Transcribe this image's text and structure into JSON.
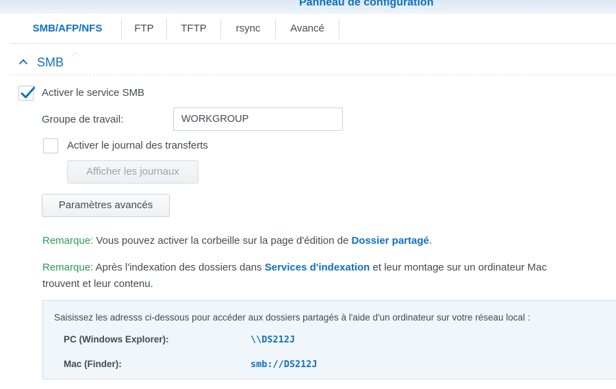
{
  "window": {
    "title": "Panneau de configuration"
  },
  "tabs": [
    {
      "label": "SMB/AFP/NFS",
      "active": true
    },
    {
      "label": "FTP"
    },
    {
      "label": "TFTP"
    },
    {
      "label": "rsync"
    },
    {
      "label": "Avancé"
    }
  ],
  "smb": {
    "section_title": "SMB",
    "enable_label": "Activer le service SMB",
    "enable_checked": true,
    "workgroup_label": "Groupe de travail:",
    "workgroup_value": "WORKGROUP",
    "transfer_log_label": "Activer le journal des transferts",
    "transfer_log_checked": false,
    "show_logs_button": "Afficher les journaux",
    "advanced_button": "Paramètres avancés"
  },
  "notes": [
    {
      "prefix": "Remarque:",
      "before": " Vous pouvez activer la corbeille sur la page d'édition de ",
      "link": "Dossier partagé",
      "after": "."
    },
    {
      "prefix": "Remarque:",
      "before": " Après l'indexation des dossiers dans ",
      "link": "Services d'indexation",
      "after": " et leur montage sur un ordinateur Mac",
      "line2": "trouvent et leur contenu."
    }
  ],
  "info": {
    "intro": "Saisissez les adresss ci-dessous pour accéder aux dossiers partagés à l'aide d'un ordinateur sur votre réseau local :",
    "rows": [
      {
        "key": "PC (Windows Explorer):",
        "value": "\\\\DS212J"
      },
      {
        "key": "Mac (Finder):",
        "value": "smb://DS212J"
      }
    ]
  },
  "colors": {
    "accent": "#0f70c2",
    "note_prefix": "#2a9a55",
    "text": "#414b55",
    "info_bg": "#f1f6fb"
  }
}
